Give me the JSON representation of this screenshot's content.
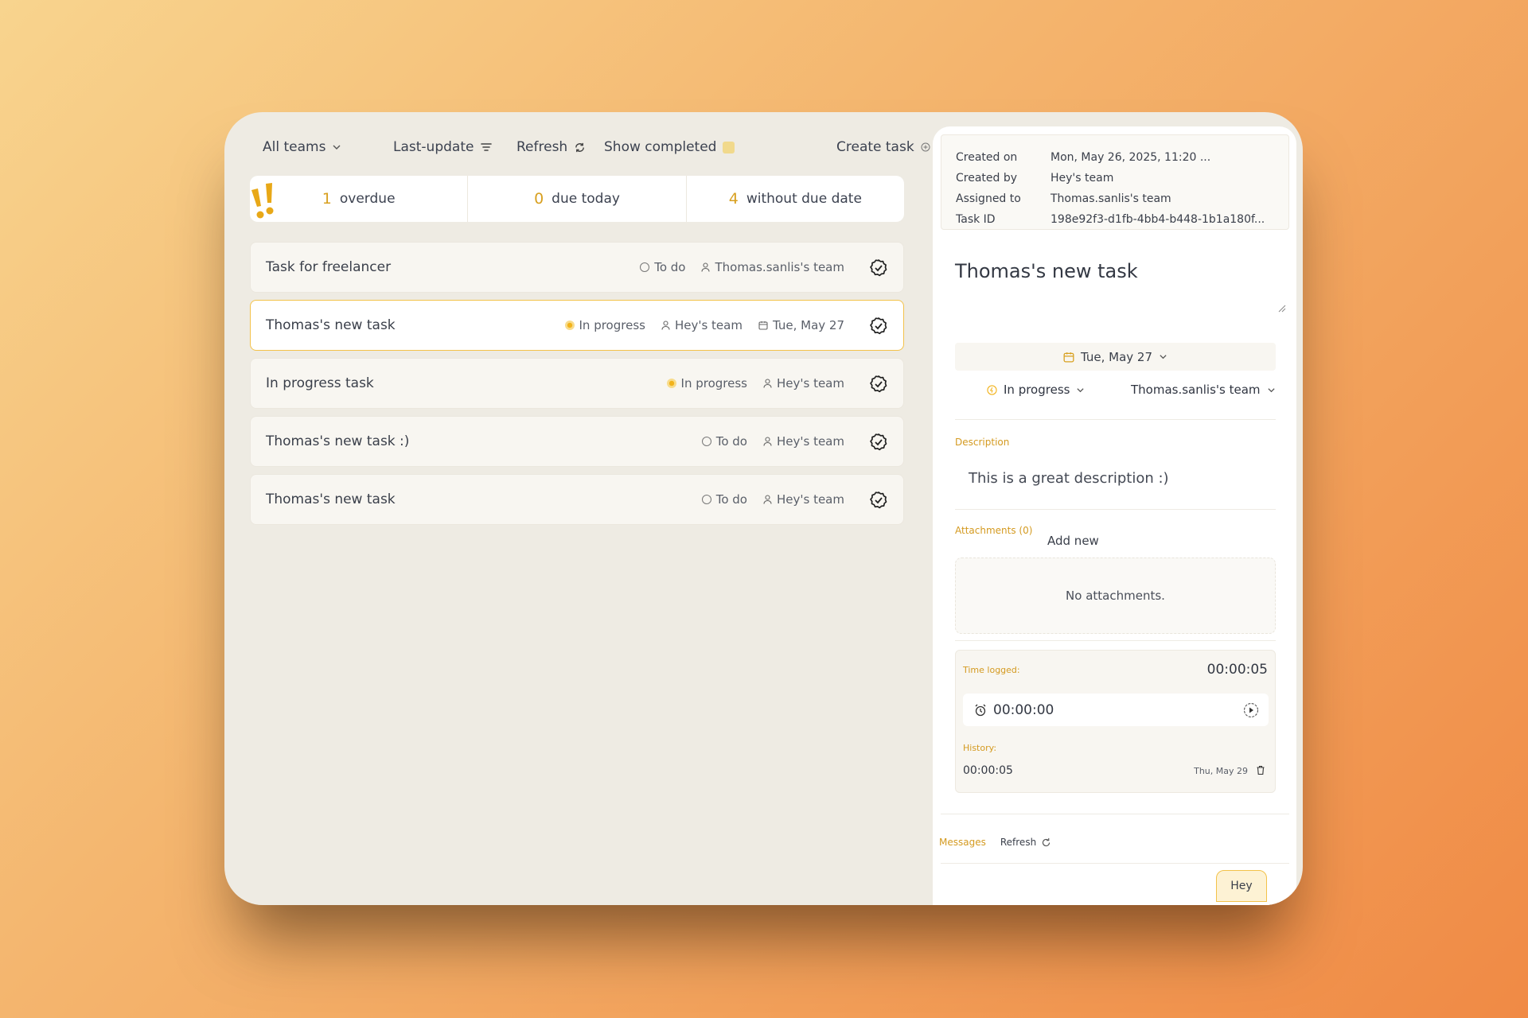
{
  "toolbar": {
    "teams_label": "All teams",
    "sort_label": "Last-update",
    "refresh_label": "Refresh",
    "show_completed_label": "Show completed",
    "create_task_label": "Create task"
  },
  "stats": [
    {
      "num": "1",
      "label": "overdue"
    },
    {
      "num": "0",
      "label": "due today"
    },
    {
      "num": "4",
      "label": "without due date"
    }
  ],
  "tasks": [
    {
      "title": "Task for freelancer",
      "status": "To do",
      "status_type": "todo",
      "team": "Thomas.sanlis's team",
      "date": ""
    },
    {
      "title": "Thomas's new task",
      "status": "In progress",
      "status_type": "progress",
      "team": "Hey's team",
      "date": "Tue, May 27"
    },
    {
      "title": "In progress task",
      "status": "In progress",
      "status_type": "progress",
      "team": "Hey's team",
      "date": ""
    },
    {
      "title": "Thomas's new task :)",
      "status": "To do",
      "status_type": "todo",
      "team": "Hey's team",
      "date": ""
    },
    {
      "title": "Thomas's new task",
      "status": "To do",
      "status_type": "todo",
      "team": "Hey's team",
      "date": ""
    }
  ],
  "detail": {
    "info": {
      "created_on_label": "Created on",
      "created_on": "Mon, May 26, 2025, 11:20 ...",
      "created_by_label": "Created by",
      "created_by": "Hey's team",
      "assigned_to_label": "Assigned to",
      "assigned_to": "Thomas.sanlis's team",
      "task_id_label": "Task ID",
      "task_id": "198e92f3-d1fb-4bb4-b448-1b1a180f..."
    },
    "title": "Thomas's new task",
    "due_date": "Tue, May 27",
    "status": "In progress",
    "team": "Thomas.sanlis's team",
    "description_label": "Description",
    "description": "This is a great description :)",
    "attachments_label": "Attachments (0)",
    "add_new_label": "Add new",
    "no_attachments": "No attachments.",
    "time_logged_label": "Time logged:",
    "time_logged": "00:00:05",
    "timer_value": "00:00:00",
    "history_label": "History:",
    "history_entry": "00:00:05",
    "history_date": "Thu, May 29",
    "messages_label": "Messages",
    "messages_refresh_label": "Refresh",
    "message": "Hey"
  },
  "colors": {
    "accent": "#d8a020",
    "selected_border": "#f3c24a",
    "in_progress": "#f2b31c"
  }
}
